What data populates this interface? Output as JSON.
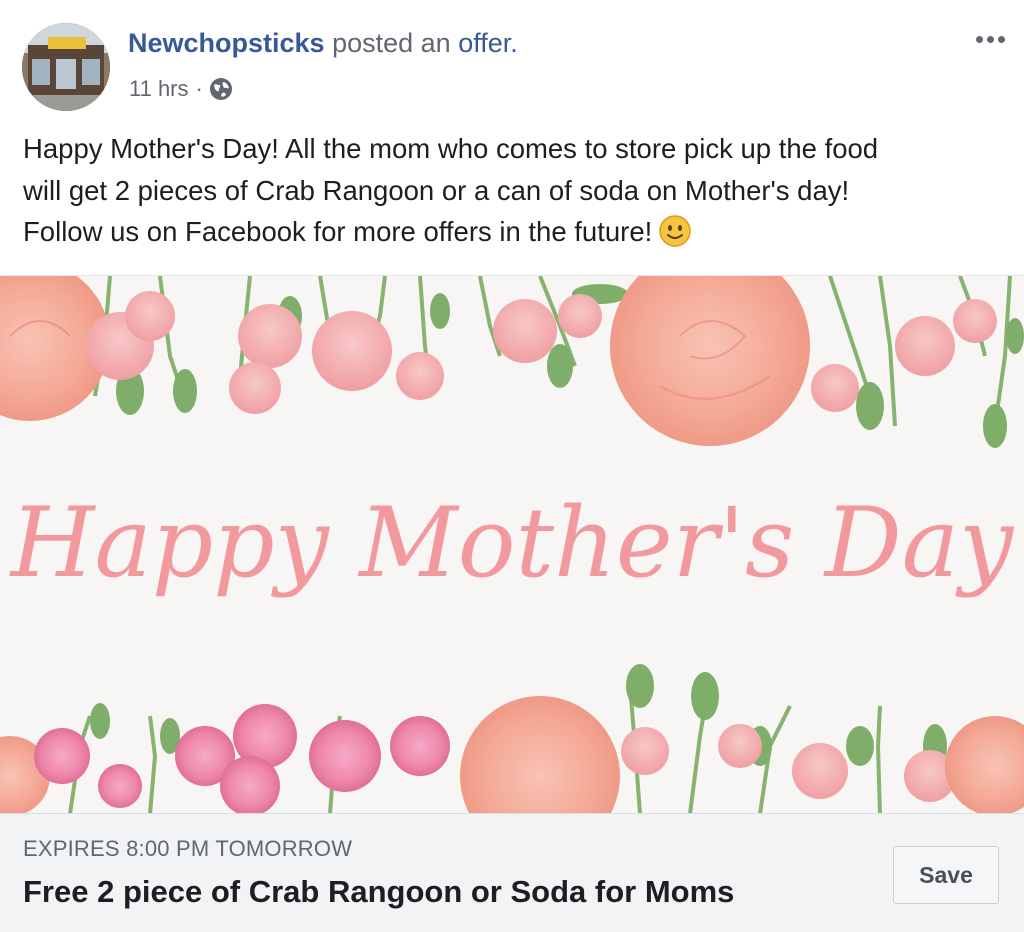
{
  "post": {
    "author_name": "Newchopsticks",
    "action_text": "posted an",
    "action_object": "offer.",
    "timestamp": "11 hrs",
    "separator": "·",
    "privacy_icon": "globe-icon",
    "more_icon": "more-options-icon",
    "text_lines": [
      "Happy Mother's Day! All the mom who comes to store pick up the food",
      "will get 2 pieces of Crab Rangoon or a can of soda on Mother's day!",
      "Follow us on Facebook for more offers in the future!"
    ],
    "emoji": "slightly-smiling-face-icon"
  },
  "image": {
    "greeting_text": "Happy Mother's Day",
    "colors": {
      "script_pink": "#f2999e",
      "rose_pink": "#f4a79b",
      "hot_pink": "#ee87a8",
      "leaf_green": "#7fae6a"
    }
  },
  "offer": {
    "expires_label": "EXPIRES 8:00 PM TOMORROW",
    "title": "Free 2 piece of Crab Rangoon or Soda for Moms",
    "save_label": "Save"
  },
  "colors": {
    "link_blue": "#385898",
    "secondary_gray": "#616770",
    "footer_bg": "#f2f3f5"
  }
}
